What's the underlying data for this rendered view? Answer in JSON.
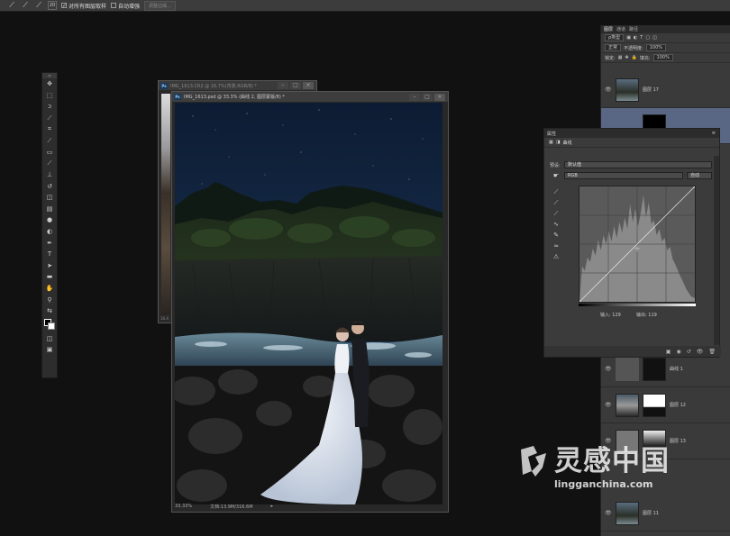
{
  "options_bar": {
    "brush_size": "20",
    "sample_all_layers": "对所有图层取样",
    "auto_enhance": "自动增强",
    "refine_edge": "调整边缘..."
  },
  "documents": [
    {
      "title": "IMG_1613.CR2 @ 16.7%(背景,RGB/8) *",
      "status": "16.4"
    },
    {
      "title": "IMG_1613.psd @ 33.3% (曲线 2, 图层蒙版/8) *",
      "zoom": "33.33%",
      "status": "文档:13.9M/316.6M"
    }
  ],
  "layers_panel": {
    "tabs": [
      "图层",
      "通道",
      "路径"
    ],
    "filter": "ρ类型",
    "blend_mode": "正常",
    "opacity_label": "不透明度:",
    "opacity": "100%",
    "lock_label": "锁定:",
    "fill_label": "填充:",
    "fill": "100%",
    "layers": [
      {
        "name": "图层 17"
      },
      {
        "name": ""
      },
      {
        "name": "曲线 1"
      },
      {
        "name": "图层 12"
      },
      {
        "name": "图层 13"
      },
      {
        "name": "图层 11"
      }
    ]
  },
  "curves_panel": {
    "panel_title": "属性",
    "adjustment": "曲线",
    "preset_label": "预设:",
    "preset": "默认值",
    "channel": "RGB",
    "auto_button": "自动",
    "input_label": "输入:",
    "input_value": "129",
    "output_label": "输出:",
    "output_value": "119"
  },
  "watermark": {
    "brand": "灵感中国",
    "url": "lingganchina.com"
  }
}
